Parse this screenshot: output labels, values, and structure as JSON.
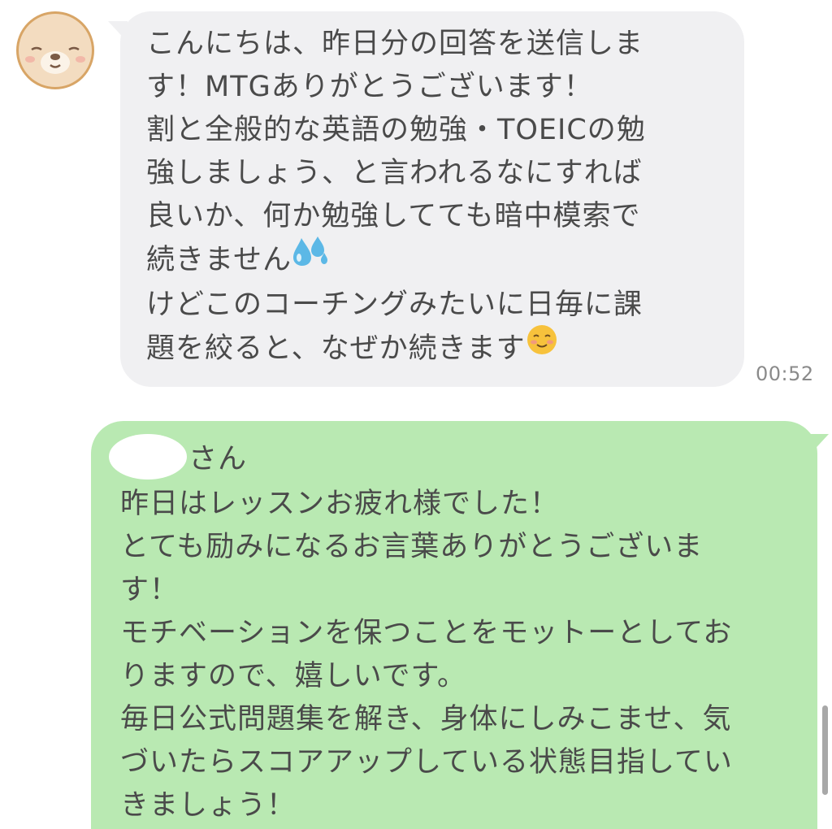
{
  "incoming": {
    "lines": [
      "こんにちは、昨日分の回答を送信しま",
      "す！MTGありがとうございます！",
      "割と全般的な英語の勉強・TOEICの勉",
      "強しましょう、と言われるなにすれば",
      "良いか、何か勉強してても暗中模索で",
      "続きません",
      "けどこのコーチングみたいに日毎に課",
      "題を絞ると、なぜか続きます"
    ],
    "timestamp": "00:52",
    "bubble_color": "#f0f0f2"
  },
  "outgoing": {
    "name_suffix": "さん",
    "lines": [
      "昨日はレッスンお疲れ様でした！",
      "とても励みになるお言葉ありがとうございま",
      "す！",
      "モチベーションを保つことをモットーとしてお",
      "りますので、嬉しいです。",
      "毎日公式問題集を解き、身体にしみこませ、気",
      "づいたらスコアアップしている状態目指してい",
      "きましょう！"
    ],
    "bubble_color": "#b9e9b2"
  },
  "icons": {
    "sweat": "sweat-droplets-icon",
    "smile": "smiling-face-icon",
    "avatar": "bear-avatar"
  }
}
